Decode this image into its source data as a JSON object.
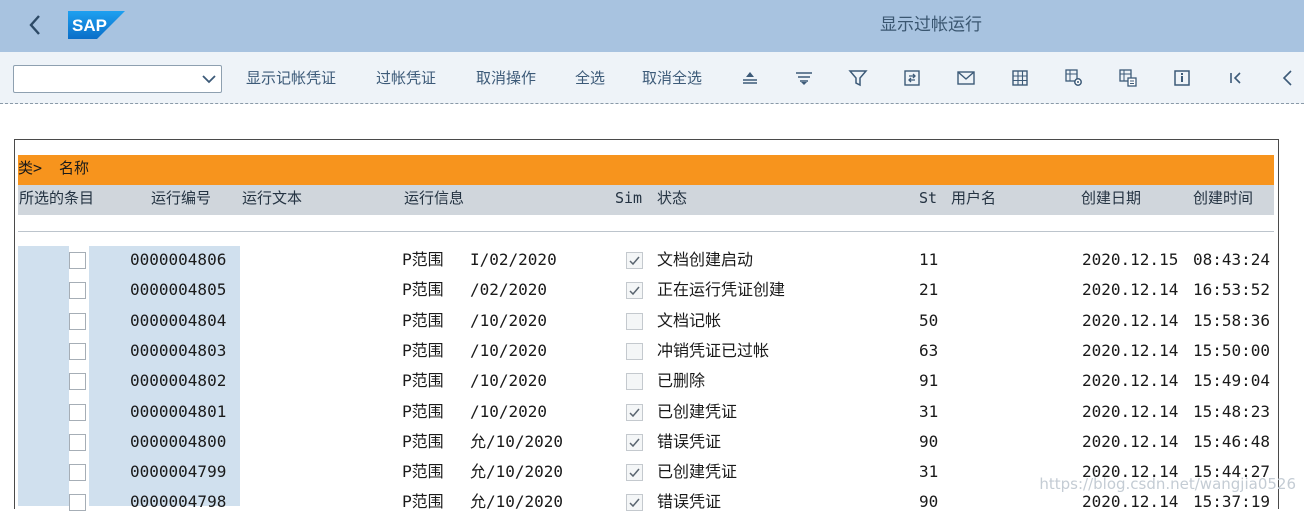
{
  "header": {
    "title": "显示过帐运行",
    "logo_text": "SAP",
    "back_icon": "chevron-left-icon"
  },
  "toolbar": {
    "select_value": "",
    "buttons": [
      {
        "label": "显示记帐凭证"
      },
      {
        "label": "过帐凭证"
      },
      {
        "label": "取消操作"
      },
      {
        "label": "全选"
      },
      {
        "label": "取消全选"
      }
    ],
    "icons": [
      "sort-ascending-icon",
      "sort-descending-icon",
      "filter-icon",
      "export-icon",
      "mail-icon",
      "layout-grid-icon",
      "layout-settings-icon",
      "layout-select-icon",
      "info-icon",
      "first-page-icon",
      "collapse-left-icon"
    ]
  },
  "table": {
    "group_label": "类>",
    "group_name": "名称",
    "columns": [
      {
        "label": "所选的条目"
      },
      {
        "label": "运行编号"
      },
      {
        "label": "运行文本"
      },
      {
        "label": "运行信息"
      },
      {
        "label": "Sim"
      },
      {
        "label": "状态"
      },
      {
        "label": "St"
      },
      {
        "label": "用户名"
      },
      {
        "label": "创建日期"
      },
      {
        "label": "创建时间"
      }
    ],
    "rows": [
      {
        "run_no": "0000004806",
        "info": "P范围",
        "period": "I/02/2020",
        "sim": true,
        "status": "文档创建启动",
        "st": "11",
        "date": "2020.12.15",
        "time": "08:43:24"
      },
      {
        "run_no": "0000004805",
        "info": "P范围",
        "period": "/02/2020",
        "sim": true,
        "status": "正在运行凭证创建",
        "st": "21",
        "date": "2020.12.14",
        "time": "16:53:52"
      },
      {
        "run_no": "0000004804",
        "info": "P范围",
        "period": "/10/2020",
        "sim": false,
        "status": "文档记帐",
        "st": "50",
        "date": "2020.12.14",
        "time": "15:58:36"
      },
      {
        "run_no": "0000004803",
        "info": "P范围",
        "period": "/10/2020",
        "sim": false,
        "status": "冲销凭证已过帐",
        "st": "63",
        "date": "2020.12.14",
        "time": "15:50:00"
      },
      {
        "run_no": "0000004802",
        "info": "P范围",
        "period": "/10/2020",
        "sim": false,
        "status": "已删除",
        "st": "91",
        "date": "2020.12.14",
        "time": "15:49:04"
      },
      {
        "run_no": "0000004801",
        "info": "P范围",
        "period": "/10/2020",
        "sim": true,
        "status": "已创建凭证",
        "st": "31",
        "date": "2020.12.14",
        "time": "15:48:23"
      },
      {
        "run_no": "0000004800",
        "info": "P范围",
        "period": "允/10/2020",
        "sim": true,
        "status": "错误凭证",
        "st": "90",
        "date": "2020.12.14",
        "time": "15:46:48"
      },
      {
        "run_no": "0000004799",
        "info": "P范围",
        "period": "允/10/2020",
        "sim": true,
        "status": "已创建凭证",
        "st": "31",
        "date": "2020.12.14",
        "time": "15:44:27"
      },
      {
        "run_no": "0000004798",
        "info": "P范围",
        "period": "允/10/2020",
        "sim": true,
        "status": "错误凭证",
        "st": "90",
        "date": "2020.12.14",
        "time": "15:37:19"
      }
    ]
  },
  "watermark": "https://blog.csdn.net/wangjia0526"
}
